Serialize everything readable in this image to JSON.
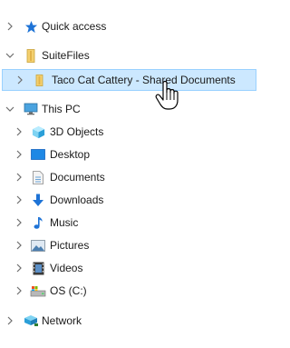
{
  "tree": {
    "quick_access": {
      "label": "Quick access",
      "icon": "star-icon",
      "accent": "#1e73d6"
    },
    "suitefiles": {
      "label": "SuiteFiles",
      "icon": "suitefiles-folder-icon"
    },
    "shared_docs": {
      "label": "Taco Cat Cattery - Shared Documents",
      "icon": "folder-icon",
      "selected_bg": "#cce8ff"
    },
    "this_pc": {
      "label": "This PC",
      "icon": "computer-icon"
    },
    "pc_children": [
      {
        "label": "3D Objects",
        "icon": "3d-objects-icon"
      },
      {
        "label": "Desktop",
        "icon": "desktop-icon"
      },
      {
        "label": "Documents",
        "icon": "documents-icon"
      },
      {
        "label": "Downloads",
        "icon": "downloads-icon"
      },
      {
        "label": "Music",
        "icon": "music-icon"
      },
      {
        "label": "Pictures",
        "icon": "pictures-icon"
      },
      {
        "label": "Videos",
        "icon": "videos-icon"
      },
      {
        "label": "OS (C:)",
        "icon": "drive-icon"
      }
    ],
    "network": {
      "label": "Network",
      "icon": "network-icon"
    }
  }
}
